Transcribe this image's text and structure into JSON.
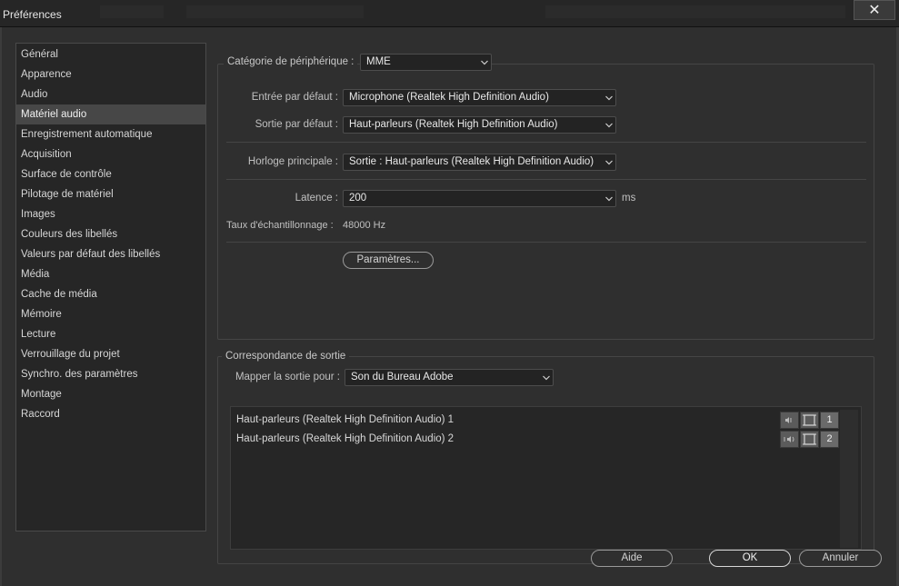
{
  "window": {
    "title": "Préférences",
    "close_glyph": "✕"
  },
  "sidebar": {
    "items": [
      {
        "label": "Général"
      },
      {
        "label": "Apparence"
      },
      {
        "label": "Audio"
      },
      {
        "label": "Matériel audio",
        "selected": true
      },
      {
        "label": "Enregistrement automatique"
      },
      {
        "label": "Acquisition"
      },
      {
        "label": "Surface de contrôle"
      },
      {
        "label": "Pilotage de matériel"
      },
      {
        "label": "Images"
      },
      {
        "label": "Couleurs des libellés"
      },
      {
        "label": "Valeurs par défaut des libellés"
      },
      {
        "label": "Média"
      },
      {
        "label": "Cache de média"
      },
      {
        "label": "Mémoire"
      },
      {
        "label": "Lecture"
      },
      {
        "label": "Verrouillage du projet"
      },
      {
        "label": "Synchro. des paramètres"
      },
      {
        "label": "Montage"
      },
      {
        "label": "Raccord"
      }
    ]
  },
  "device": {
    "category_label": "Catégorie de périphérique :",
    "category_value": "MME",
    "input_label": "Entrée par défaut :",
    "input_value": "Microphone (Realtek High Definition Audio)",
    "output_label": "Sortie par défaut :",
    "output_value": "Haut-parleurs (Realtek High Definition Audio)",
    "clock_label": "Horloge principale :",
    "clock_value": "Sortie : Haut-parleurs (Realtek High Definition Audio)",
    "latency_label": "Latence :",
    "latency_value": "200",
    "latency_unit": "ms",
    "sample_rate_label": "Taux d'échantillonnage :",
    "sample_rate_value": "48000 Hz",
    "settings_button": "Paramètres..."
  },
  "output_mapping": {
    "title": "Correspondance de sortie",
    "map_label": "Mapper la sortie pour :",
    "map_value": "Son du Bureau Adobe",
    "channels": [
      {
        "label": "Haut-parleurs (Realtek High Definition Audio) 1",
        "number": "1",
        "icon": "speaker-left-icon"
      },
      {
        "label": "Haut-parleurs (Realtek High Definition Audio) 2",
        "number": "2",
        "icon": "speaker-right-icon"
      }
    ]
  },
  "footer": {
    "help": "Aide",
    "ok": "OK",
    "cancel": "Annuler"
  },
  "colors": {
    "background": "#2f2f2f",
    "panel": "#262626",
    "selected": "#474747",
    "text": "#c8c8c8"
  }
}
